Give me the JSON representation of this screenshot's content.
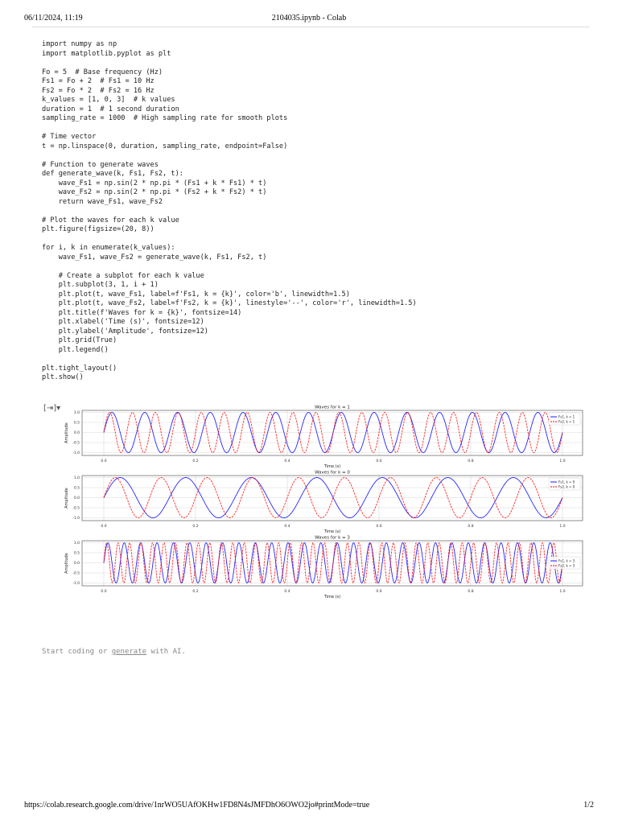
{
  "header": {
    "datetime": "06/11/2024, 11:19",
    "title": "2104035.ipynb - Colab"
  },
  "code_cell": {
    "lines": [
      "import numpy as np",
      "import matplotlib.pyplot as plt",
      "",
      "Fo = 5  # Base frequency (Hz)",
      "Fs1 = Fo + 2  # Fs1 = 10 Hz",
      "Fs2 = Fo * 2  # Fs2 = 16 Hz",
      "k_values = [1, 0, 3]  # k values",
      "duration = 1  # 1 second duration",
      "sampling_rate = 1000  # High sampling rate for smooth plots",
      "",
      "# Time vector",
      "t = np.linspace(0, duration, sampling_rate, endpoint=False)",
      "",
      "# Function to generate waves",
      "def generate_wave(k, Fs1, Fs2, t):",
      "    wave_Fs1 = np.sin(2 * np.pi * (Fs1 + k * Fs1) * t)",
      "    wave_Fs2 = np.sin(2 * np.pi * (Fs2 + k * Fs2) * t)",
      "    return wave_Fs1, wave_Fs2",
      "",
      "# Plot the waves for each k value",
      "plt.figure(figsize=(20, 8))",
      "",
      "for i, k in enumerate(k_values):",
      "    wave_Fs1, wave_Fs2 = generate_wave(k, Fs1, Fs2, t)",
      "",
      "    # Create a subplot for each k value",
      "    plt.subplot(3, 1, i + 1)",
      "    plt.plot(t, wave_Fs1, label=f'Fs1, k = {k}', color='b', linewidth=1.5)",
      "    plt.plot(t, wave_Fs2, label=f'Fs2, k = {k}', linestyle='--', color='r', linewidth=1.5)",
      "    plt.title(f'Waves for k = {k}', fontsize=14)",
      "    plt.xlabel('Time (s)', fontsize=12)",
      "    plt.ylabel('Amplitude', fontsize=12)",
      "    plt.grid(True)",
      "    plt.legend()",
      "",
      "plt.tight_layout()",
      "plt.show()"
    ]
  },
  "output_icon": "output-toggle-icon",
  "chart_data": [
    {
      "type": "line",
      "title": "Waves for k = 1",
      "xlabel": "Time (s)",
      "ylabel": "Amplitude",
      "xlim": [
        0,
        1
      ],
      "ylim": [
        -1,
        1
      ],
      "grid": true,
      "legend_placement": "top-right",
      "xticks": [
        "0.0",
        "0.2",
        "0.4",
        "0.6",
        "0.8",
        "1.0"
      ],
      "yticks": [
        "1.0",
        "0.5",
        "0.0",
        "-0.5",
        "-1.0"
      ],
      "series": [
        {
          "name": "Fs1, k = 1",
          "function": "sin",
          "frequency_hz": 14,
          "color": "#0000ff",
          "style": "solid"
        },
        {
          "name": "Fs2, k = 1",
          "function": "sin",
          "frequency_hz": 20,
          "color": "#ff0000",
          "style": "dashed"
        }
      ]
    },
    {
      "type": "line",
      "title": "Waves for k = 0",
      "xlabel": "Time (s)",
      "ylabel": "Amplitude",
      "xlim": [
        0,
        1
      ],
      "ylim": [
        -1,
        1
      ],
      "grid": true,
      "legend_placement": "top-right",
      "xticks": [
        "0.0",
        "0.2",
        "0.4",
        "0.6",
        "0.8",
        "1.0"
      ],
      "yticks": [
        "1.0",
        "0.5",
        "0.0",
        "-0.5",
        "-1.0"
      ],
      "series": [
        {
          "name": "Fs1, k = 0",
          "function": "sin",
          "frequency_hz": 7,
          "color": "#0000ff",
          "style": "solid"
        },
        {
          "name": "Fs2, k = 0",
          "function": "sin",
          "frequency_hz": 10,
          "color": "#ff0000",
          "style": "dashed"
        }
      ]
    },
    {
      "type": "line",
      "title": "Waves for k = 3",
      "xlabel": "Time (s)",
      "ylabel": "Amplitude",
      "xlim": [
        0,
        1
      ],
      "ylim": [
        -1,
        1
      ],
      "grid": true,
      "legend_placement": "center-right",
      "xticks": [
        "0.0",
        "0.2",
        "0.4",
        "0.6",
        "0.8",
        "1.0"
      ],
      "yticks": [
        "1.0",
        "0.5",
        "0.0",
        "-0.5",
        "-1.0"
      ],
      "series": [
        {
          "name": "Fs1, k = 3",
          "function": "sin",
          "frequency_hz": 28,
          "color": "#0000ff",
          "style": "solid"
        },
        {
          "name": "Fs2, k = 3",
          "function": "sin",
          "frequency_hz": 40,
          "color": "#ff0000",
          "style": "dashed"
        }
      ]
    }
  ],
  "empty_cell": {
    "prefix": "Start coding or ",
    "link": "generate",
    "suffix": " with AI."
  },
  "footer": {
    "url": "https://colab.research.google.com/drive/1nrWO5UAfOKHw1FD8N4sJMFDhO6OWO2jo#printMode=true",
    "page": "1/2"
  }
}
